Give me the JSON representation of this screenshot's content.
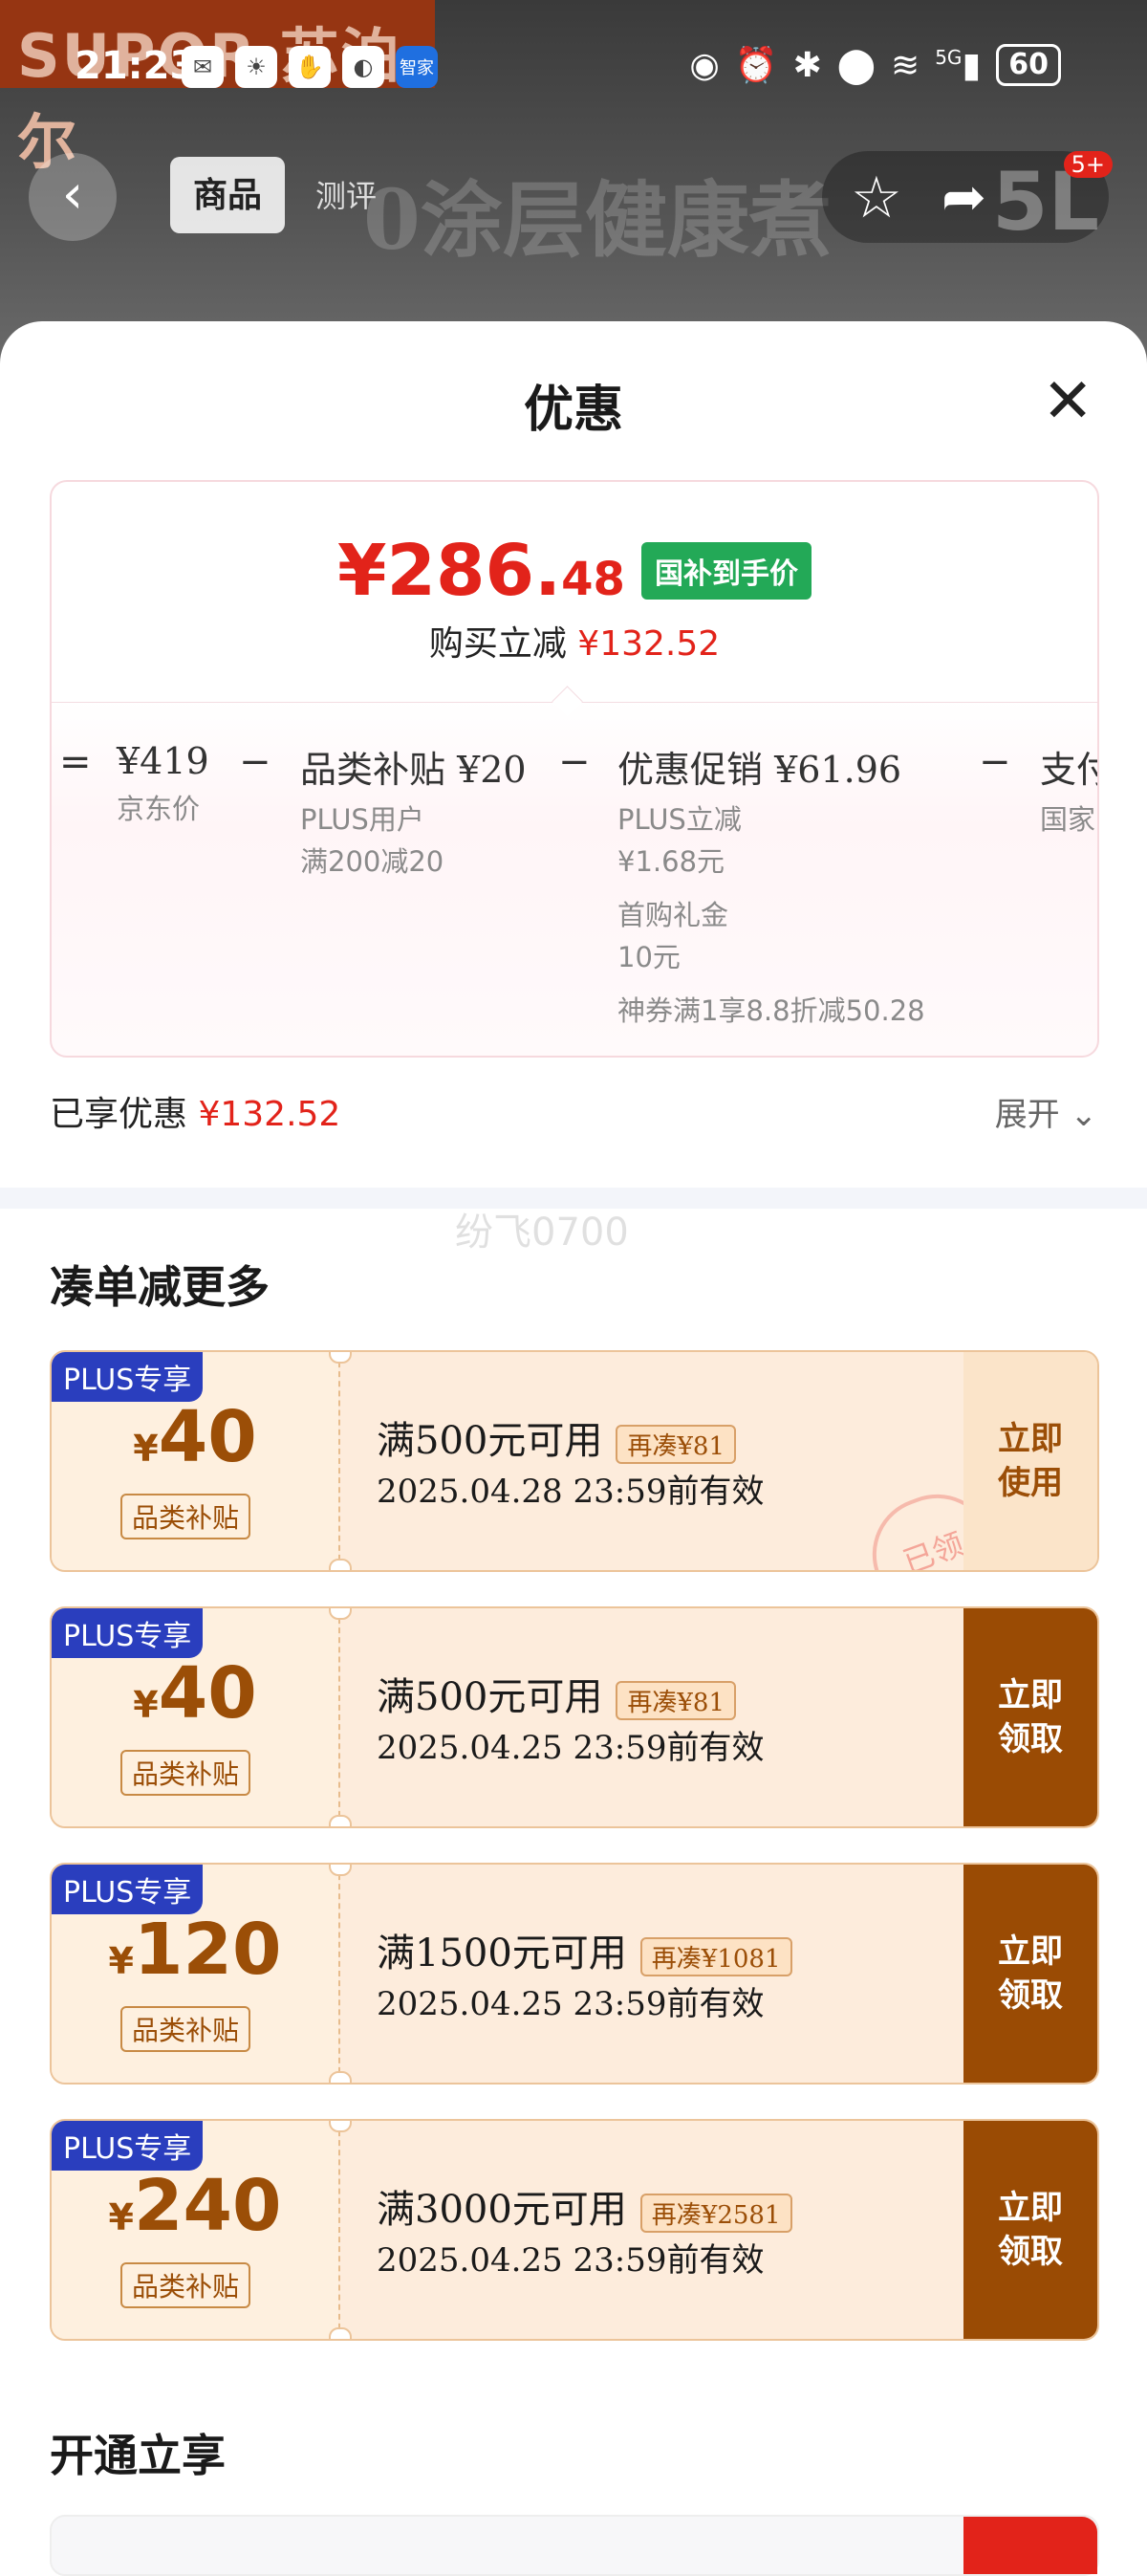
{
  "status_bar": {
    "time": "21:23",
    "app_icon_label": "智家",
    "network": "5G",
    "battery": "60"
  },
  "brand": {
    "name": "SUPOR 苏泊尔"
  },
  "nav": {
    "tab_goods": "商品",
    "tab_review": "测评",
    "ghost_title": "0涂层健康煮",
    "capacity": "5L",
    "cart_badge": "5+"
  },
  "sheet": {
    "title": "优惠",
    "final_price_int": "¥286.",
    "final_price_dec": "48",
    "final_tag": "国补到手价",
    "reduce_label": "购买立减",
    "reduce_value": "¥132.52",
    "formula": {
      "eq": "=",
      "jd_price": "¥419",
      "jd_price_label": "京东价",
      "minus": "−",
      "category_sub_head": "品类补贴 ¥20",
      "category_sub_line1": "PLUS用户",
      "category_sub_line2": "满200减20",
      "promo_head": "优惠促销 ¥61.96",
      "promo_line1": "PLUS立减",
      "promo_line2": "¥1.68元",
      "promo_line3": "首购礼金",
      "promo_line4": "10元",
      "promo_line5": "神券满1享8.8折减50.28",
      "pay_head": "支付",
      "pay_line1": "国家"
    },
    "enjoyed_label": "已享优惠",
    "enjoyed_value": "¥132.52",
    "expand_label": "展开",
    "watermark": "纷飞0700"
  },
  "more_section": {
    "title": "凑单减更多",
    "coupons": [
      {
        "tag": "PLUS专享",
        "yen": "¥",
        "amount": "40",
        "category": "品类补贴",
        "condition": "满500元可用",
        "extra": "再凑¥81",
        "valid": "2025.04.28 23:59前有效",
        "button": "立即使用",
        "stamp": "已领"
      },
      {
        "tag": "PLUS专享",
        "yen": "¥",
        "amount": "40",
        "category": "品类补贴",
        "condition": "满500元可用",
        "extra": "再凑¥81",
        "valid": "2025.04.25 23:59前有效",
        "button": "立即领取"
      },
      {
        "tag": "PLUS专享",
        "yen": "¥",
        "amount": "120",
        "category": "品类补贴",
        "condition": "满1500元可用",
        "extra": "再凑¥1081",
        "valid": "2025.04.25 23:59前有效",
        "button": "立即领取"
      },
      {
        "tag": "PLUS专享",
        "yen": "¥",
        "amount": "240",
        "category": "品类补贴",
        "condition": "满3000元可用",
        "extra": "再凑¥2581",
        "valid": "2025.04.25 23:59前有效",
        "button": "立即领取"
      }
    ]
  },
  "open_section": {
    "title": "开通立享"
  },
  "colors": {
    "red": "#e2231a",
    "brown": "#9a4b04",
    "green": "#23a957",
    "plus_blue": "#2a3ebe"
  }
}
